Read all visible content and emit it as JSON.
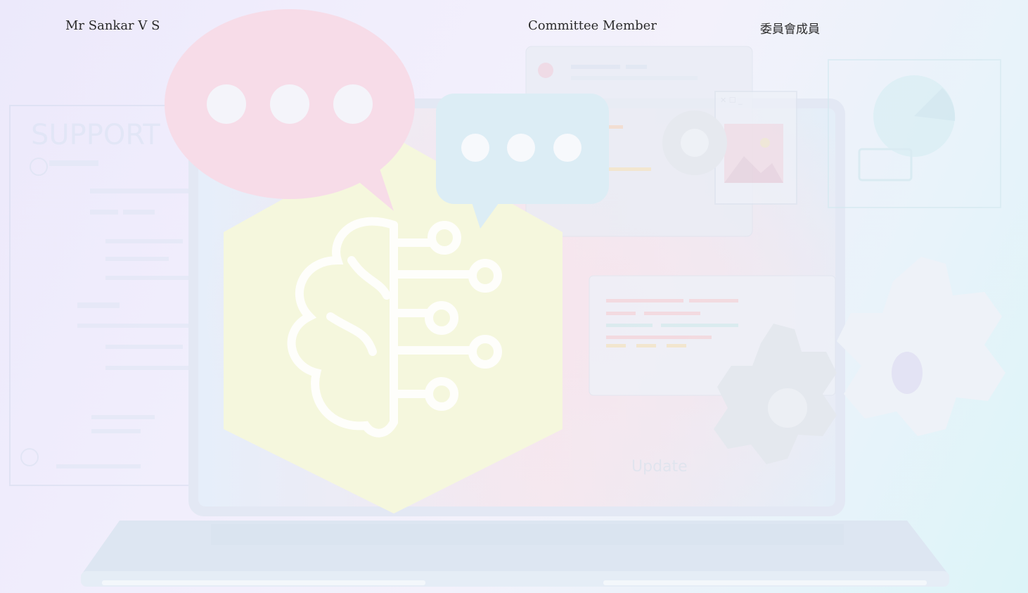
{
  "rows": [
    {
      "name": "Mr Sankar V S",
      "role_en": "Committee Member",
      "role_zh": "委員會成員"
    }
  ],
  "background": {
    "support_label": "SUPPORT",
    "update_label": "Update",
    "colors": {
      "bg_left": "#ece9fb",
      "bg_right": "#dcf4f8",
      "bubble_red": "#f7dce8",
      "bubble_blue": "#dcedf5",
      "brain_shape": "#f5f7dd"
    },
    "icons": [
      "speech-bubble-icon",
      "brain-circuit-icon",
      "gear-icon",
      "laptop-illustration",
      "image-window-icon"
    ]
  }
}
